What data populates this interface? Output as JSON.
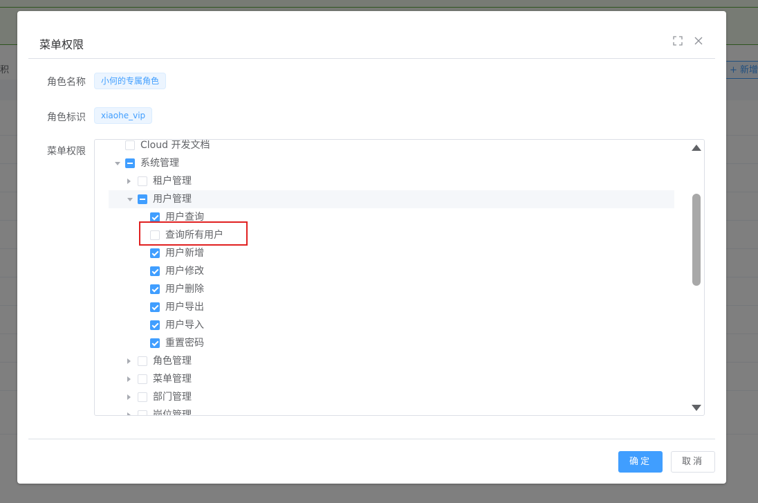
{
  "background": {
    "left_toolbar_text": "积",
    "add_button": "+ 新增"
  },
  "dialog": {
    "title": "菜单权限",
    "role_name_label": "角色名称",
    "role_name_value": "小何的专属角色",
    "role_key_label": "角色标识",
    "role_key_value": "xiaohe_vip",
    "menu_perm_label": "菜单权限",
    "confirm_label": "确定",
    "cancel_label": "取消"
  },
  "tree": [
    {
      "label": "Cloud 开发文档",
      "level": 0,
      "arrow": "none",
      "check": "unchecked"
    },
    {
      "label": "系统管理",
      "level": 0,
      "arrow": "down",
      "check": "half"
    },
    {
      "label": "租户管理",
      "level": 1,
      "arrow": "right",
      "check": "unchecked"
    },
    {
      "label": "用户管理",
      "level": 1,
      "arrow": "down",
      "check": "half"
    },
    {
      "label": "用户查询",
      "level": 2,
      "arrow": "none",
      "check": "checked"
    },
    {
      "label": "查询所有用户",
      "level": 2,
      "arrow": "none",
      "check": "unchecked"
    },
    {
      "label": "用户新增",
      "level": 2,
      "arrow": "none",
      "check": "checked"
    },
    {
      "label": "用户修改",
      "level": 2,
      "arrow": "none",
      "check": "checked"
    },
    {
      "label": "用户删除",
      "level": 2,
      "arrow": "none",
      "check": "checked"
    },
    {
      "label": "用户导出",
      "level": 2,
      "arrow": "none",
      "check": "checked"
    },
    {
      "label": "用户导入",
      "level": 2,
      "arrow": "none",
      "check": "checked"
    },
    {
      "label": "重置密码",
      "level": 2,
      "arrow": "none",
      "check": "checked"
    },
    {
      "label": "角色管理",
      "level": 1,
      "arrow": "right",
      "check": "unchecked"
    },
    {
      "label": "菜单管理",
      "level": 1,
      "arrow": "right",
      "check": "unchecked"
    },
    {
      "label": "部门管理",
      "level": 1,
      "arrow": "right",
      "check": "unchecked"
    },
    {
      "label": "岗位管理",
      "level": 1,
      "arrow": "right",
      "check": "unchecked"
    }
  ],
  "colors": {
    "primary": "#409eff",
    "highlight_box": "#e02020"
  }
}
